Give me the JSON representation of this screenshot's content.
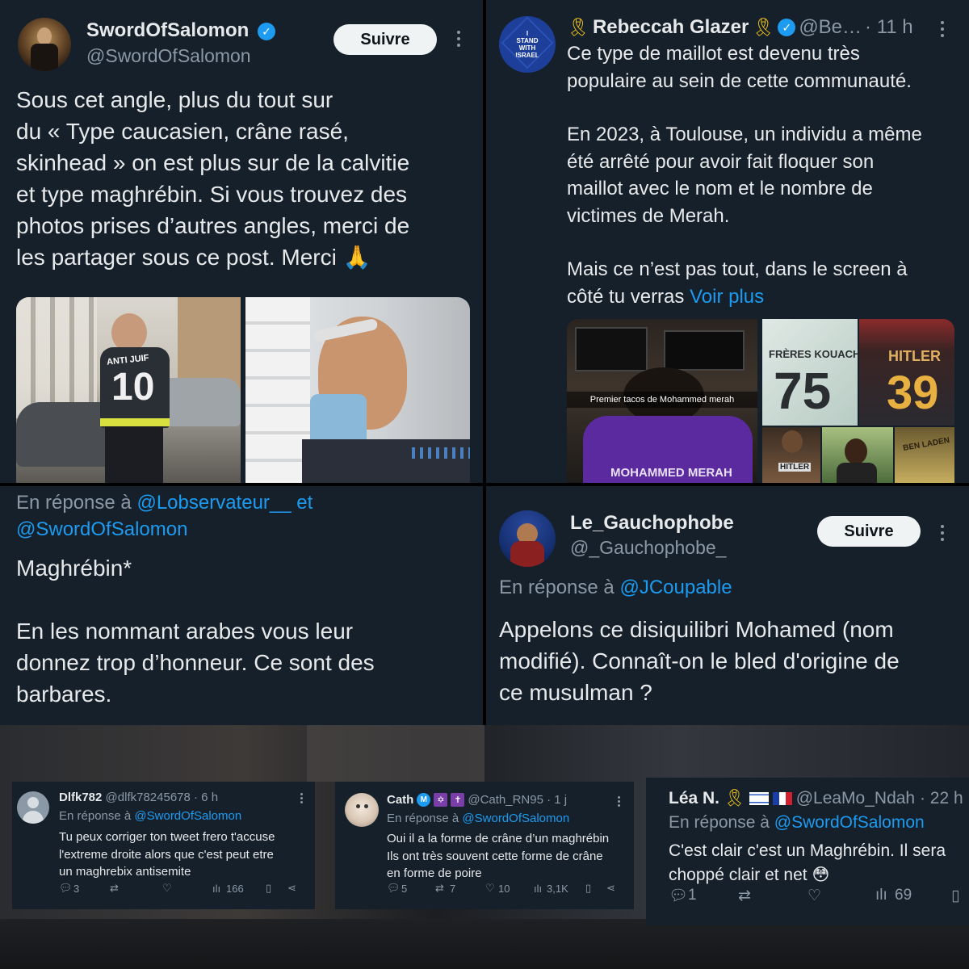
{
  "tweet1": {
    "name": "SwordOfSalomon",
    "handle": "@SwordOfSalomon",
    "follow": "Suivre",
    "lines": [
      "Sous cet angle, plus du tout sur",
      "du « Type caucasien, crâne rasé,",
      "skinhead » on est plus sur de la calvitie",
      "et type maghrébin. Si vous trouvez des",
      "photos prises d’autres angles, merci de",
      "les partager sous ce post. Merci 🙏"
    ],
    "jersey_text": "ANTI JUIF",
    "jersey_number": "10"
  },
  "tweet2": {
    "name": "Rebeccah Glazer",
    "handle": "@Be…",
    "time": "· 11 h",
    "avatar_text": [
      "I",
      "STAND",
      "WITH",
      "ISRAEL"
    ],
    "p1": [
      "Ce type de maillot est devenu très",
      "populaire au sein de cette communauté."
    ],
    "p2": [
      "En 2023, à Toulouse, un individu a même",
      "été arrêté pour avoir fait floquer son",
      "maillot avec le nom et le nombre de",
      "victimes de Merah."
    ],
    "p3a": "Mais ce n’est pas tout, dans le screen à",
    "p3b": "côté tu verras",
    "see_more": "Voir plus",
    "img_caption": "Premier tacos de Mohammed merah",
    "jersey_merah": "MOHAMMED MERAH",
    "kouachi": "FRÈRES KOUACHI",
    "kouachi_num": "75",
    "hitler": "HITLER",
    "hitler_num": "39",
    "hitler_small": "HITLER",
    "binladen": "BEN LADEN"
  },
  "tweet3": {
    "reply_prefix": "En réponse à",
    "reply_user1": "@Lobservateur__",
    "reply_and": "et",
    "reply_user2": "@SwordOfSalomon",
    "line1": "Maghrébin*",
    "lines": [
      "En les nommant arabes vous leur",
      "donnez trop d’honneur. Ce sont des",
      "barbares."
    ]
  },
  "tweet4": {
    "name": "Le_Gauchophobe",
    "handle": "@_Gauchophobe_",
    "follow": "Suivre",
    "reply_prefix": "En réponse à",
    "reply_user": "@JCoupable",
    "lines": [
      "Appelons ce disiquilibri Mohamed (nom",
      "modifié). Connaît-on le bled d'origine de",
      "ce musulman ?"
    ]
  },
  "reply1": {
    "name": "Dlfk782",
    "handle": "@dlfk78245678 · 6 h",
    "reply_prefix": "En réponse à",
    "reply_user": "@SwordOfSalomon",
    "lines": [
      "Tu peux corriger ton tweet frero t'accuse",
      "l'extreme droite alors que c'est peut etre",
      "un maghrebix antisemite"
    ],
    "replies": "3",
    "views": "166"
  },
  "reply2": {
    "name": "Cath",
    "handle": "@Cath_RN95 · 1 j",
    "reply_prefix": "En réponse à",
    "reply_user": "@SwordOfSalomon",
    "lines": [
      "Oui il a la forme de crâne d’un maghrébin",
      "Ils ont très souvent cette forme de crâne",
      "en forme de poire"
    ],
    "replies": "5",
    "retweets": "7",
    "likes": "10",
    "views": "3,1K"
  },
  "reply3": {
    "name": "Léa N.",
    "handle": "@LeaMo_Ndah · 22 h",
    "reply_prefix": "En réponse à",
    "reply_user": "@SwordOfSalomon",
    "lines": [
      "C'est clair c'est un Maghrébin. Il sera",
      "choppé clair et net 😳"
    ],
    "replies": "1",
    "views": "69"
  }
}
